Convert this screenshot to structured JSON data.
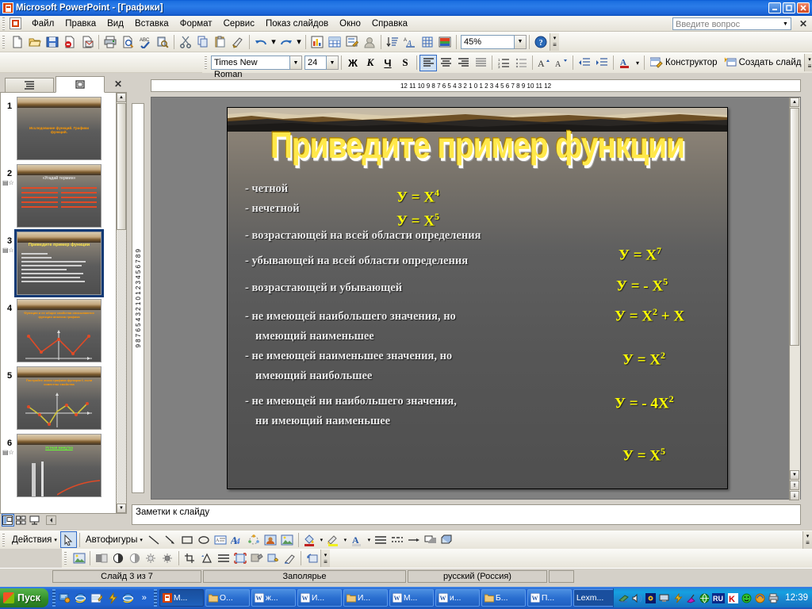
{
  "window": {
    "app_name": "Microsoft PowerPoint",
    "document_name": "Графики",
    "title": "Microsoft PowerPoint - [Графики]",
    "minimize": "_",
    "restore": "❐",
    "close": "✕",
    "inner_close": "✕"
  },
  "menu": {
    "items": [
      {
        "label": "Файл"
      },
      {
        "label": "Правка"
      },
      {
        "label": "Вид"
      },
      {
        "label": "Вставка"
      },
      {
        "label": "Формат"
      },
      {
        "label": "Сервис"
      },
      {
        "label": "Показ слайдов"
      },
      {
        "label": "Окно"
      },
      {
        "label": "Справка"
      }
    ],
    "ask_placeholder": "Введите вопрос",
    "ask_value": ""
  },
  "toolbar_standard": {
    "zoom_value": "45%",
    "buttons": [
      "new-document",
      "open",
      "save",
      "permission",
      "email",
      "print",
      "print-preview",
      "spelling",
      "research",
      "cut",
      "copy",
      "paste",
      "format-painter",
      "undo",
      "redo",
      "insert-chart",
      "insert-table",
      "insert-diagram",
      "insert-clipart",
      "sort",
      "format-text-effect",
      "show-grid",
      "color-scheme",
      "zoom",
      "help"
    ]
  },
  "toolbar_formatting": {
    "font_name": "Times New Roman",
    "font_size": "24",
    "bold": "Ж",
    "italic": "К",
    "underline": "Ч",
    "shadow": "S",
    "design_label": "Конструктор",
    "new_slide_label": "Создать слайд",
    "alignment_active": "align-left"
  },
  "left_panel": {
    "tab_outline": "outline-view",
    "tab_slides": "slides-view",
    "active_tab": "slides-view",
    "close": "✕",
    "slides": [
      {
        "number": "1",
        "title": "Исследование функций. Графики функций.",
        "selected": false,
        "has_animation": false
      },
      {
        "number": "2",
        "title": "«Угадай термин»",
        "selected": false,
        "has_animation": true
      },
      {
        "number": "3",
        "title": "Приведите пример функции",
        "selected": true,
        "has_animation": true
      },
      {
        "number": "4",
        "title": "Функция и ее общие свойства описываются функции анализа графика",
        "selected": false,
        "has_animation": false
      },
      {
        "number": "5",
        "title": "Постройте эскиз графика функции f, если известны свойства",
        "selected": false,
        "has_animation": false
      },
      {
        "number": "6",
        "title": "Устная минутка",
        "selected": false,
        "has_animation": true
      }
    ]
  },
  "rulers": {
    "horizontal": "12 11 10  9  8  7  6  5  4  3  2  1  0  1  2  3  4  5  6  7  8  9 10 11 12",
    "vertical": "9  8  7  6  5  4  3  2  1  0  1  2  3  4  5  6  7  8  9"
  },
  "slide": {
    "title": "Приведите пример функции",
    "bullets": [
      {
        "text": "- четной",
        "formula": "У = X",
        "sup": "4"
      },
      {
        "text": "- нечетной",
        "formula": "У = X",
        "sup": "5"
      },
      {
        "text": "- возрастающей на всей  области определения",
        "formula": "У = X",
        "sup": "7"
      },
      {
        "text": "- убывающей на всей  области определения",
        "formula": "У = - X",
        "sup": "5"
      },
      {
        "text": "- возрастающей и убывающей",
        "formula": "У = X",
        "sup": "2",
        "formula_tail": " + X"
      },
      {
        "text": "- не имеющей наибольшего значения, но\n   имеющий наименьшее",
        "formula": "У = X",
        "sup": "2"
      },
      {
        "text": "- не имеющей наименьшее значения, но\n   имеющий наибольшее",
        "formula": "У = - 4X",
        "sup": "2"
      },
      {
        "text": "- не имеющей ни наибольшего значения,\n   ни имеющий наименьшее",
        "formula": "У = X",
        "sup": "5"
      }
    ],
    "lines": [
      "- четной",
      "- нечетной",
      "- возрастающей на всей  области определения",
      "- убывающей на всей  области определения",
      "- возрастающей и убывающей",
      "- не имеющей наибольшего значения, но",
      "имеющий наименьшее",
      "- не имеющей наименьшее значения, но",
      "имеющий наибольшее",
      "- не имеющей ни наибольшего значения,",
      "ни имеющий наименьшее"
    ],
    "colors": {
      "title_text": "#ffe84a",
      "bullet_text": "#e8e8e8",
      "formula_text": "#ffff00",
      "background": "#595959"
    }
  },
  "notes": {
    "placeholder": "Заметки к слайду",
    "text": "Заметки к слайду"
  },
  "drawing_toolbar": {
    "actions_label": "Действия",
    "autoshapes_label": "Автофигуры",
    "tools": [
      "select-arrow",
      "line",
      "arrow",
      "rectangle",
      "oval",
      "text-box",
      "word-art",
      "diagram",
      "clip-art",
      "insert-picture",
      "fill-color",
      "line-color",
      "font-color"
    ]
  },
  "status_bar": {
    "slide_indicator": "Слайд 3 из 7",
    "design_template": "Заполярье",
    "language": "русский (Россия)"
  },
  "taskbar": {
    "start_label": "Пуск",
    "quick_launch": [
      "show-desktop",
      "internet-explorer",
      "outlook-express",
      "winamp",
      "browser"
    ],
    "overflow": "»",
    "tasks": [
      {
        "label": "М...",
        "icon": "powerpoint-icon",
        "active": true
      },
      {
        "label": "О...",
        "icon": "folder-icon",
        "active": false
      },
      {
        "label": "ж...",
        "icon": "word-icon",
        "active": false
      },
      {
        "label": "И...",
        "icon": "word-icon",
        "active": false
      },
      {
        "label": "И...",
        "icon": "folder-icon",
        "active": false
      },
      {
        "label": "М...",
        "icon": "word-icon",
        "active": false
      },
      {
        "label": "и...",
        "icon": "word-icon",
        "active": false
      },
      {
        "label": "Б...",
        "icon": "folder-icon",
        "active": false
      },
      {
        "label": "П...",
        "icon": "word-icon",
        "active": false
      },
      {
        "label": "Lexm...",
        "icon": "app-icon",
        "active": false
      }
    ],
    "tray_icons": [
      "network-icon",
      "volume-icon",
      "radio-icon",
      "display-icon",
      "winamp-icon",
      "satellite-icon",
      "globe-icon",
      "language-ru-icon",
      "kaspersky-icon",
      "smiley-icon",
      "update-icon",
      "printer-icon"
    ],
    "language_indicator": "RU",
    "clock": "12:39"
  }
}
